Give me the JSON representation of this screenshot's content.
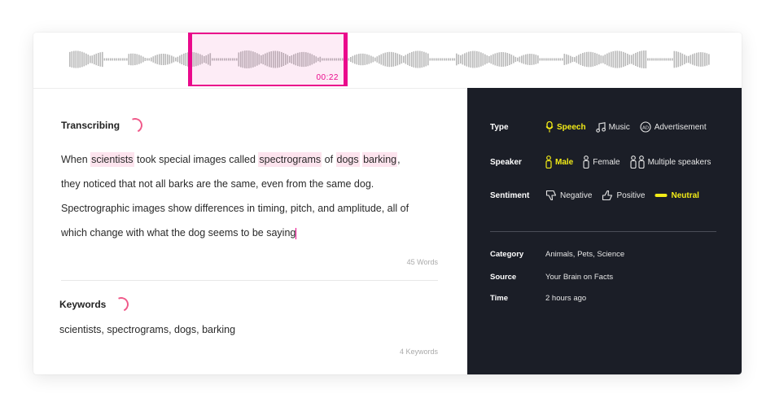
{
  "waveform": {
    "selection_time": "00:22",
    "accent": "#ea0a8c"
  },
  "transcript": {
    "title": "Transcribing",
    "lines": [
      [
        {
          "t": "When ",
          "h": false
        },
        {
          "t": "scientists",
          "h": true
        },
        {
          "t": " took special images called ",
          "h": false
        },
        {
          "t": "spectrograms",
          "h": true
        },
        {
          "t": " of ",
          "h": false
        },
        {
          "t": "dogs",
          "h": true
        },
        {
          "t": " ",
          "h": false
        },
        {
          "t": "barking",
          "h": true
        },
        {
          "t": ",",
          "h": false
        }
      ],
      [
        {
          "t": "they noticed that not all barks are the same, even from the same dog.",
          "h": false
        }
      ],
      [
        {
          "t": "Spectrographic images show differences in timing, pitch, and amplitude, all of",
          "h": false
        }
      ],
      [
        {
          "t": "which change with what the dog seems to be saying",
          "h": false
        }
      ]
    ],
    "word_count": "45 Words"
  },
  "keywords": {
    "title": "Keywords",
    "text": "scientists, spectrograms, dogs, barking",
    "count": "4 Keywords"
  },
  "classification": {
    "highlight_color": "#f3ec17",
    "type": {
      "label": "Type",
      "options": [
        {
          "label": "Speech",
          "icon": "microphone-icon",
          "active": true
        },
        {
          "label": "Music",
          "icon": "music-note-icon",
          "active": false
        },
        {
          "label": "Advertisement",
          "icon": "ad-icon",
          "active": false
        }
      ]
    },
    "speaker": {
      "label": "Speaker",
      "options": [
        {
          "label": "Male",
          "icon": "person-icon",
          "active": true
        },
        {
          "label": "Female",
          "icon": "person-icon",
          "active": false
        },
        {
          "label": "Multiple speakers",
          "icon": "people-icon",
          "active": false
        }
      ]
    },
    "sentiment": {
      "label": "Sentiment",
      "options": [
        {
          "label": "Negative",
          "icon": "thumbs-down-icon",
          "active": false
        },
        {
          "label": "Positive",
          "icon": "thumbs-up-icon",
          "active": false
        },
        {
          "label": "Neutral",
          "icon": "neutral-dash-icon",
          "active": true
        }
      ]
    }
  },
  "meta": {
    "category": {
      "label": "Category",
      "value": "Animals, Pets, Science"
    },
    "source": {
      "label": "Source",
      "value": "Your Brain on Facts"
    },
    "time": {
      "label": "Time",
      "value": "2 hours ago"
    }
  }
}
